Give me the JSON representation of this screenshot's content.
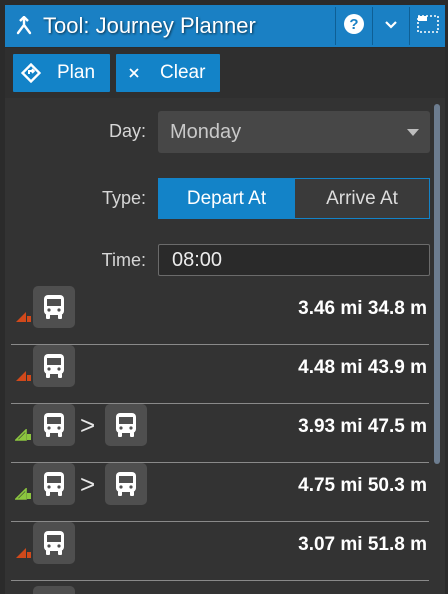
{
  "title": "Tool: Journey Planner",
  "titlebar": {
    "tool_icon": "merge-arrow-icon",
    "help_icon": "help-icon",
    "collapse_icon": "chevron-down-icon",
    "float_icon": "undock-icon"
  },
  "toolbar": {
    "plan_label": "Plan",
    "plan_icon": "directions-icon",
    "clear_label": "Clear",
    "clear_icon": "close-icon"
  },
  "form": {
    "day_label": "Day:",
    "day_value": "Monday",
    "type_label": "Type:",
    "type_options": [
      "Depart At",
      "Arrive At"
    ],
    "type_selected": "Depart At",
    "time_label": "Time:",
    "time_value": "08:00"
  },
  "results": [
    {
      "quality": "poor",
      "legs": [
        "bus-icon"
      ],
      "distance": "3.46 mi",
      "duration": "34.8 m",
      "summary": "3.46 mi 34.8 m"
    },
    {
      "quality": "poor",
      "legs": [
        "bus-icon"
      ],
      "distance": "4.48 mi",
      "duration": "43.9 m",
      "summary": "4.48 mi 43.9 m"
    },
    {
      "quality": "good",
      "legs": [
        "bus-icon",
        "bus-icon"
      ],
      "separator": ">",
      "distance": "3.93 mi",
      "duration": "47.5 m",
      "summary": "3.93 mi 47.5 m"
    },
    {
      "quality": "good",
      "legs": [
        "bus-icon",
        "bus-icon"
      ],
      "separator": ">",
      "distance": "4.75 mi",
      "duration": "50.3 m",
      "summary": "4.75 mi 50.3 m"
    },
    {
      "quality": "poor",
      "legs": [
        "bus-icon"
      ],
      "distance": "3.07 mi",
      "duration": "51.8 m",
      "summary": "3.07 mi 51.8 m"
    }
  ],
  "colors": {
    "accent": "#1a80c4",
    "button": "#1383c8",
    "quality_poor": "#d1491b",
    "quality_good": "#8cc63f"
  }
}
